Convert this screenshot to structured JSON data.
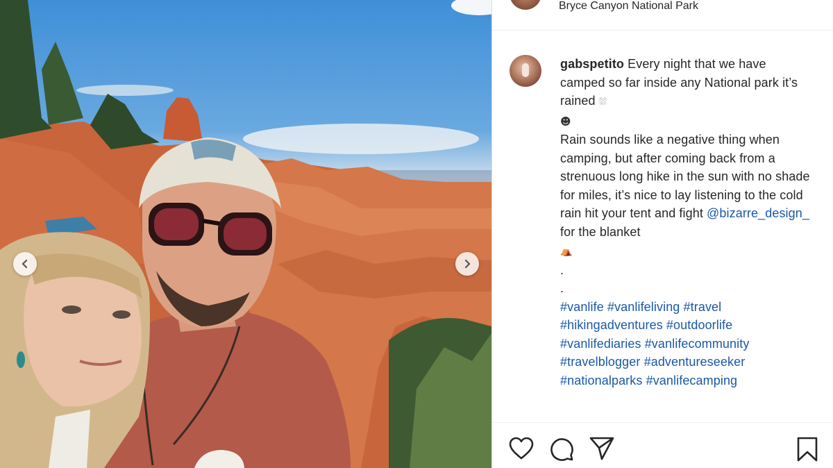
{
  "post": {
    "location": "Bryce Canyon National Park",
    "username": "gabspetito",
    "caption_line1": " Every night that we have camped so far inside any National park it’s rained ",
    "emoji_rain": "⛆",
    "emoji_face": "☻",
    "caption_para2_a": "Rain sounds like a negative thing when camping, but after coming back from a strenuous long hike in the sun with no shade for miles, it’s nice to lay listening to the cold rain hit your tent and fight ",
    "mention": "@bizarre_design_",
    "caption_para2_b": " for the blanket",
    "emoji_tent": "⛺",
    "dot1": ".",
    "dot2": ".",
    "hashtags": [
      "#vanlife",
      "#vanlifeliving",
      "#travel",
      "#hikingadventures",
      "#outdoorlife",
      "#vanlifediaries",
      "#vanlifecommunity",
      "#travelblogger",
      "#adventureseeker",
      "#nationalparks",
      "#vanlifecamping"
    ]
  },
  "icons": {
    "prev": "chevron-left-icon",
    "next": "chevron-right-icon",
    "like": "heart-icon",
    "comment": "comment-icon",
    "share": "paper-plane-icon",
    "save": "bookmark-icon"
  },
  "colors": {
    "link": "#1a58a6",
    "text": "#262626",
    "divider": "#efefef"
  }
}
